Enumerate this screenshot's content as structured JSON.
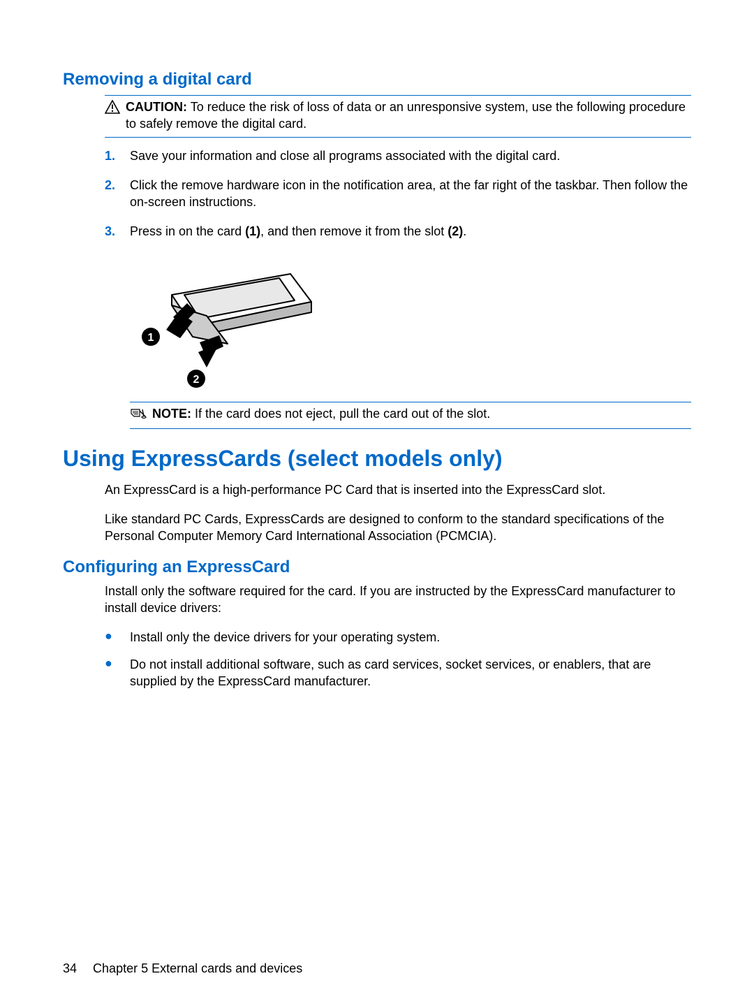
{
  "section1": {
    "heading": "Removing a digital card",
    "caution_label": "CAUTION:",
    "caution_text": "To reduce the risk of loss of data or an unresponsive system, use the following procedure to safely remove the digital card.",
    "steps": [
      {
        "n": "1.",
        "text": "Save your information and close all programs associated with the digital card."
      },
      {
        "n": "2.",
        "text": "Click the remove hardware icon in the notification area, at the far right of the taskbar. Then follow the on-screen instructions."
      },
      {
        "n": "3.",
        "pre": "Press in on the card ",
        "b1": "(1)",
        "mid": ", and then remove it from the slot ",
        "b2": "(2)",
        "post": "."
      }
    ],
    "note_label": "NOTE:",
    "note_text": "If the card does not eject, pull the card out of the slot."
  },
  "section2": {
    "heading": "Using ExpressCards (select models only)",
    "p1": "An ExpressCard is a high-performance PC Card that is inserted into the ExpressCard slot.",
    "p2": "Like standard PC Cards, ExpressCards are designed to conform to the standard specifications of the Personal Computer Memory Card International Association (PCMCIA)."
  },
  "section3": {
    "heading": "Configuring an ExpressCard",
    "p1": "Install only the software required for the card. If you are instructed by the ExpressCard manufacturer to install device drivers:",
    "bullets": [
      "Install only the device drivers for your operating system.",
      "Do not install additional software, such as card services, socket services, or enablers, that are supplied by the ExpressCard manufacturer."
    ]
  },
  "footer": {
    "page": "34",
    "chapter": "Chapter 5   External cards and devices"
  }
}
